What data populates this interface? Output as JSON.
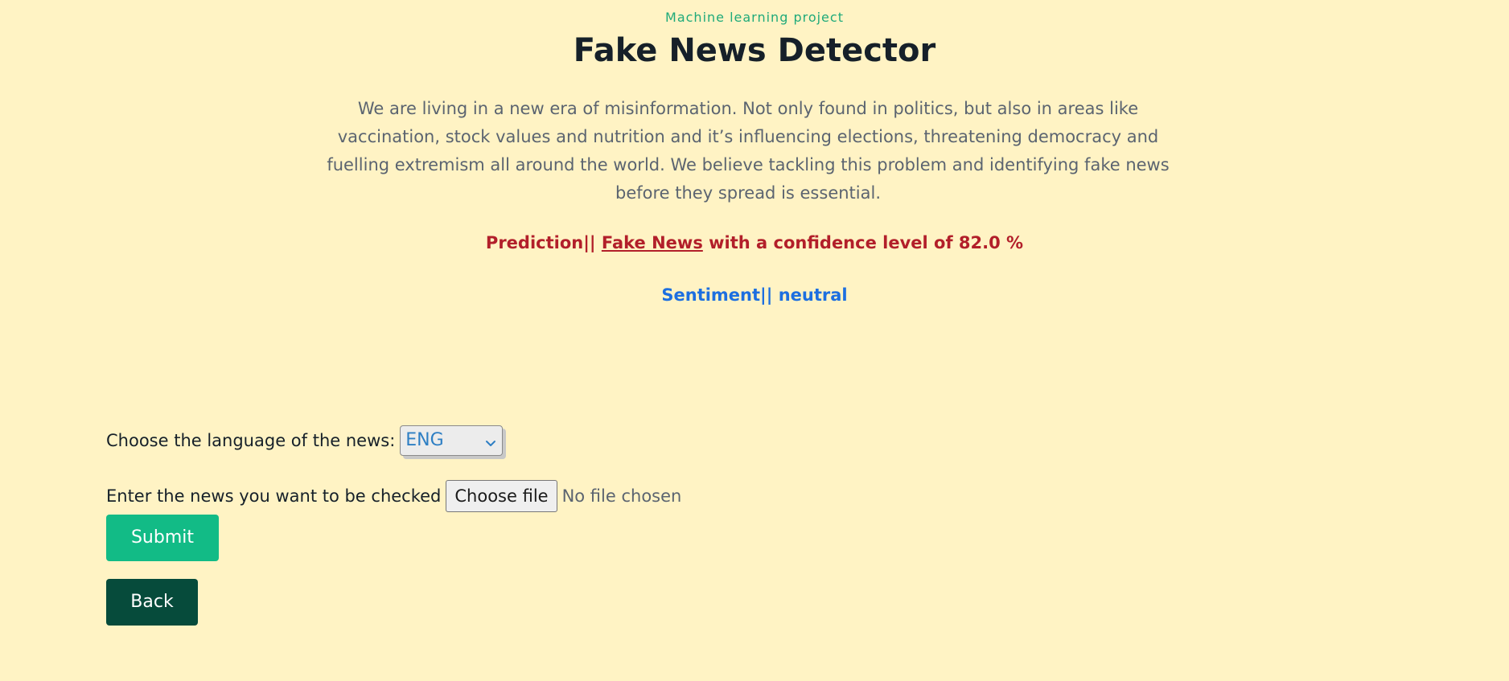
{
  "header": {
    "eyebrow": "Machine learning project",
    "title": "Fake News Detector",
    "description": "We are living in a new era of misinformation. Not only found in politics, but also in areas like vaccination, stock values and nutrition and it’s influencing elections, threatening democracy and fuelling extremism all around the world. We believe tackling this problem and identifying fake news before they spread is essential."
  },
  "result": {
    "prediction_prefix": "Prediction|| ",
    "prediction_link": "Fake News",
    "prediction_suffix": " with a confidence level of 82.0 %",
    "sentiment": "Sentiment|| neutral"
  },
  "form": {
    "language_label": "Choose the language of the news:",
    "language_selected": "ENG",
    "file_label": "Enter the news you want to be checked",
    "file_button": "Choose file",
    "file_status": "No file chosen",
    "submit_label": "Submit",
    "back_label": "Back"
  },
  "icons": {
    "select_arrow": "chevron-down-icon"
  },
  "colors": {
    "background": "#fff3c4",
    "accent_green": "#12bb86",
    "dark_green": "#064b3b",
    "prediction_red": "#b21f2a",
    "sentiment_blue": "#1d6fe0"
  }
}
